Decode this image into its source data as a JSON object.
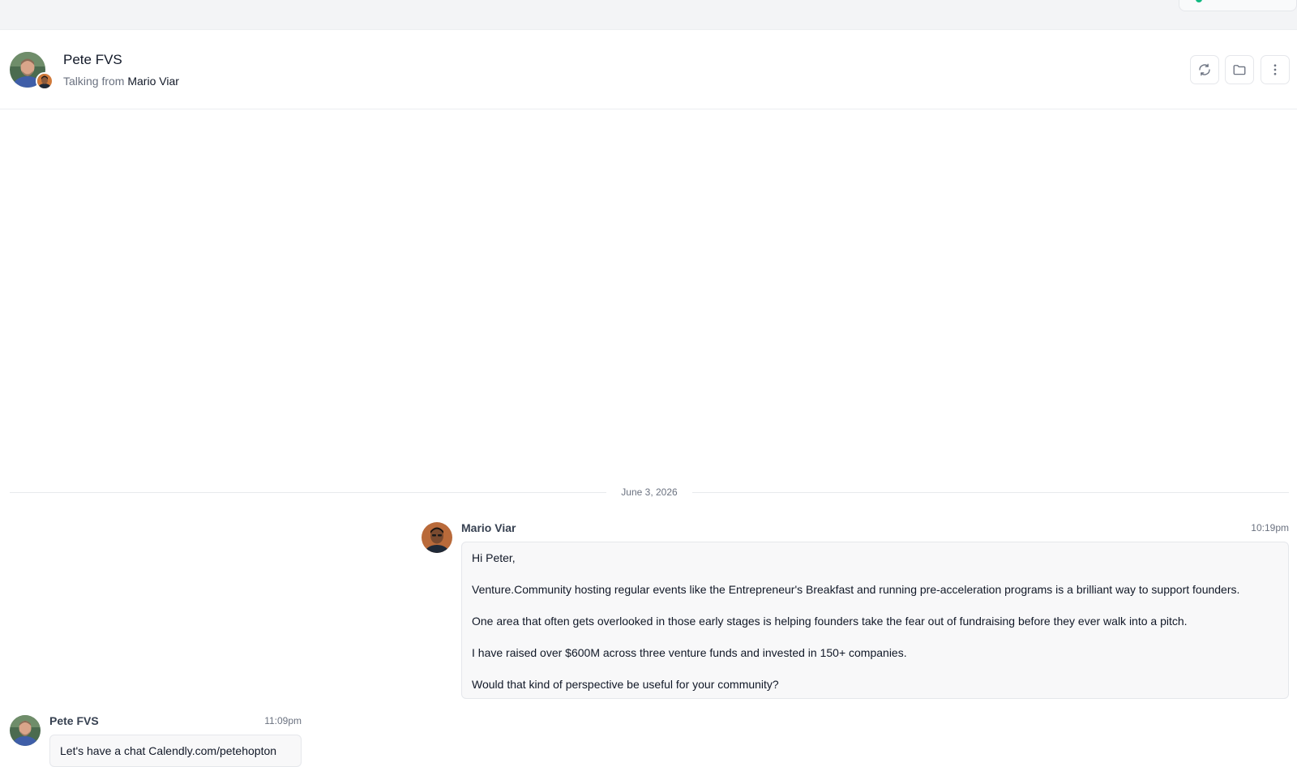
{
  "header": {
    "contact_name": "Pete FVS",
    "talking_from_label": "Talking from",
    "talking_from_name": "Mario Viar"
  },
  "icons": {
    "sync": "refresh-icon",
    "folder": "folder-icon",
    "more": "more-vertical-icon"
  },
  "conversation": {
    "date_separator": "June 3, 2026",
    "messages": [
      {
        "sender": "Mario Viar",
        "time": "10:19pm",
        "paragraphs": [
          "Hi Peter,",
          "Venture.Community hosting regular events like the Entrepreneur's Breakfast and running pre-acceleration programs is a brilliant way to support founders.",
          "One area that often gets overlooked in those early stages is helping founders take the fear out of fundraising before they ever walk into a pitch.",
          "I have raised over $600M across three venture funds and invested in 150+ companies.",
          "Would that kind of perspective be useful for your community?"
        ]
      },
      {
        "sender": "Pete FVS",
        "time": "11:09pm",
        "paragraphs": [
          "Let's have a chat Calendly.com/petehopton"
        ]
      }
    ]
  },
  "colors": {
    "topbar_bg": "#f3f4f6",
    "border": "#e5e7eb",
    "bubble_bg": "#f8f8f9",
    "status_green": "#10b981"
  }
}
